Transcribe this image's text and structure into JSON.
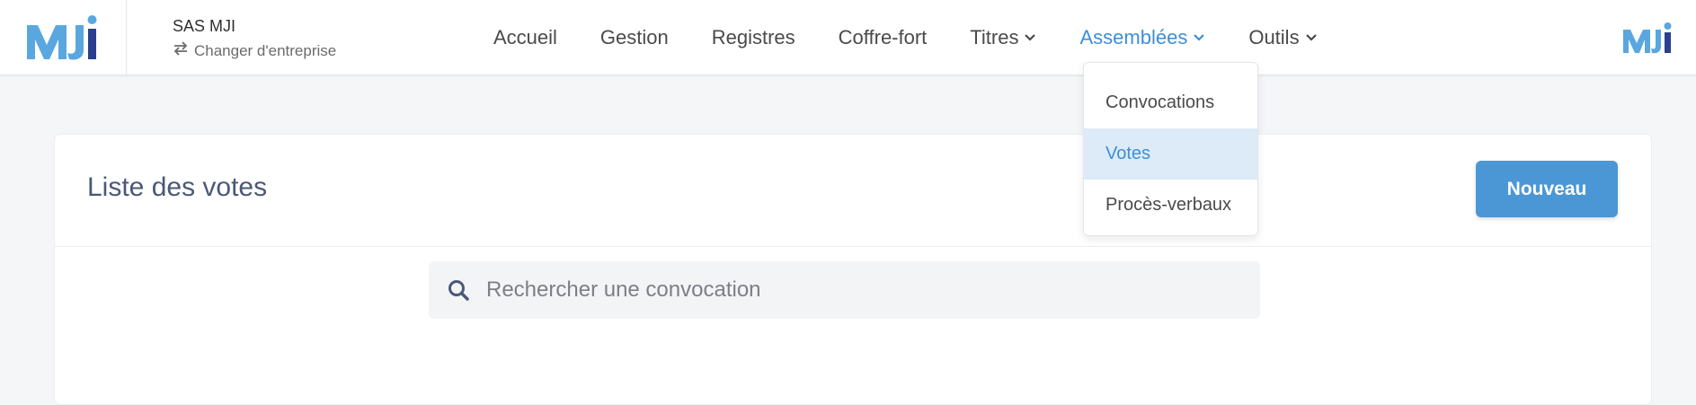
{
  "header": {
    "logo_text": "MJI",
    "company_name": "SAS MJI",
    "switch_company_label": "Changer d'entreprise"
  },
  "nav": {
    "items": [
      {
        "label": "Accueil",
        "has_dropdown": false
      },
      {
        "label": "Gestion",
        "has_dropdown": false
      },
      {
        "label": "Registres",
        "has_dropdown": false
      },
      {
        "label": "Coffre-fort",
        "has_dropdown": false
      },
      {
        "label": "Titres",
        "has_dropdown": true
      },
      {
        "label": "Assemblées",
        "has_dropdown": true,
        "active": true
      },
      {
        "label": "Outils",
        "has_dropdown": true
      }
    ]
  },
  "dropdown": {
    "items": [
      {
        "label": "Convocations",
        "selected": false
      },
      {
        "label": "Votes",
        "selected": true
      },
      {
        "label": "Procès-verbaux",
        "selected": false
      }
    ]
  },
  "page": {
    "title": "Liste des votes",
    "new_button_label": "Nouveau",
    "search_placeholder": "Rechercher une convocation",
    "search_value": ""
  },
  "colors": {
    "accent": "#3d8fd6",
    "button": "#4b97d6",
    "title": "#4a5878",
    "logo_light": "#5aa7e0",
    "logo_dark": "#2b3f8f"
  },
  "icons": {
    "switch": "swap-arrows-icon",
    "chevron": "chevron-down-icon",
    "search": "search-icon"
  }
}
